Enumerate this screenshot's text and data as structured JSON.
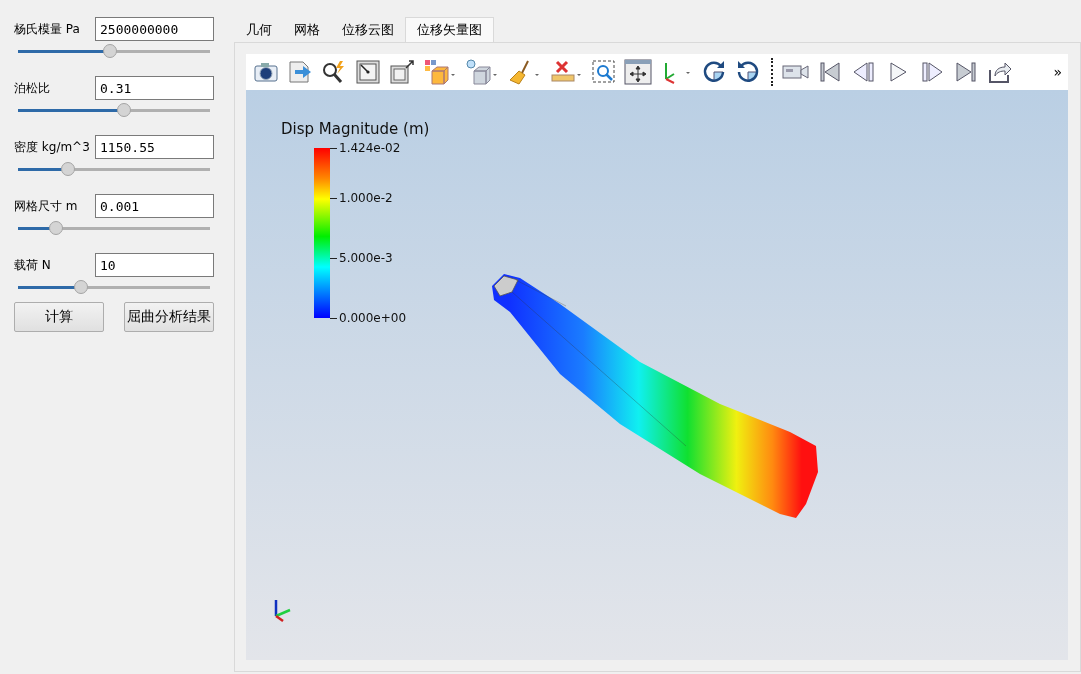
{
  "parameters": [
    {
      "label": "杨氏模量 Pa",
      "value": "2500000000",
      "level": 0.48
    },
    {
      "label": "泊松比",
      "value": "0.31",
      "level": 0.55
    },
    {
      "label": "密度 kg/m^3",
      "value": "1150.55",
      "level": 0.26
    },
    {
      "label": "网格尺寸 m",
      "value": "0.001",
      "level": 0.2
    },
    {
      "label": "载荷 N",
      "value": "10",
      "level": 0.33
    }
  ],
  "buttons": [
    "计算",
    "屈曲分析结果"
  ],
  "tabs": [
    {
      "label": "几何",
      "selected": false
    },
    {
      "label": "网格",
      "selected": false
    },
    {
      "label": "位移云图",
      "selected": false
    },
    {
      "label": "位移矢量图",
      "selected": true
    }
  ],
  "toolbar": {
    "overflow": "»"
  },
  "legend": {
    "title": "Disp Magnitude (m)",
    "ticks": [
      "1.424e-02",
      "1.000e-2",
      "5.000e-3",
      "0.000e+00"
    ]
  }
}
